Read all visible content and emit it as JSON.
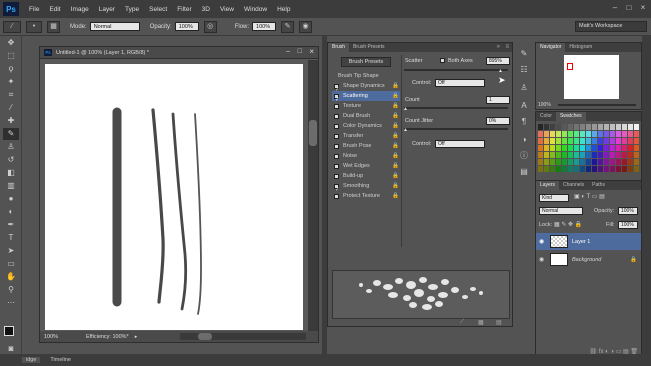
{
  "menu": {
    "logo": "Ps",
    "items": [
      "File",
      "Edit",
      "Image",
      "Layer",
      "Type",
      "Select",
      "Filter",
      "3D",
      "View",
      "Window",
      "Help"
    ]
  },
  "options": {
    "mode_label": "Mode:",
    "mode_value": "Normal",
    "opacity_label": "Opacity:",
    "opacity_value": "100%",
    "flow_label": "Flow:",
    "flow_value": "100%",
    "workspace": "Matt's Workspace"
  },
  "document": {
    "title": "Untitled-1 @ 100% (Layer 1, RGB/8) *",
    "zoom": "100%",
    "status": "Efficiency: 100%*"
  },
  "brush_panel": {
    "tabs": [
      "Brush",
      "Brush Presets"
    ],
    "presets_button": "Brush Presets",
    "tip_shape": "Brush Tip Shape",
    "options": [
      {
        "label": "Shape Dynamics",
        "checked": true,
        "locked": true
      },
      {
        "label": "Scattering",
        "checked": true,
        "locked": true,
        "selected": true
      },
      {
        "label": "Texture",
        "checked": false,
        "locked": true
      },
      {
        "label": "Dual Brush",
        "checked": false,
        "locked": true
      },
      {
        "label": "Color Dynamics",
        "checked": false,
        "locked": true
      },
      {
        "label": "Transfer",
        "checked": false,
        "locked": true
      },
      {
        "label": "Brush Pose",
        "checked": false,
        "locked": true
      },
      {
        "label": "Noise",
        "checked": false,
        "locked": true
      },
      {
        "label": "Wet Edges",
        "checked": false,
        "locked": true
      },
      {
        "label": "Build-up",
        "checked": false,
        "locked": true
      },
      {
        "label": "Smoothing",
        "checked": true,
        "locked": true
      },
      {
        "label": "Protect Texture",
        "checked": false,
        "locked": true
      }
    ],
    "scatter_label": "Scatter",
    "both_axes_label": "Both Axes",
    "scatter_value": "895%",
    "control1_label": "Control:",
    "control1_value": "Off",
    "count_label": "Count",
    "count_value": "1",
    "count_jitter_label": "Count Jitter",
    "count_jitter_value": "0%",
    "control2_label": "Control:",
    "control2_value": "Off"
  },
  "navigator": {
    "tabs": [
      "Navigator",
      "Histogram"
    ],
    "zoom": "100%"
  },
  "swatches": {
    "tabs": [
      "Color",
      "Swatches"
    ]
  },
  "layers": {
    "tabs": [
      "Layers",
      "Channels",
      "Paths"
    ],
    "kind": "Kind",
    "blend": "Normal",
    "opacity_label": "Opacity:",
    "opacity_value": "100%",
    "lock_label": "Lock:",
    "fill_label": "Fill:",
    "fill_value": "100%",
    "rows": [
      {
        "name": "Layer 1",
        "selected": true
      },
      {
        "name": "Background",
        "selected": false
      }
    ]
  },
  "bottom_tabs": [
    "idge",
    "Timeline"
  ]
}
